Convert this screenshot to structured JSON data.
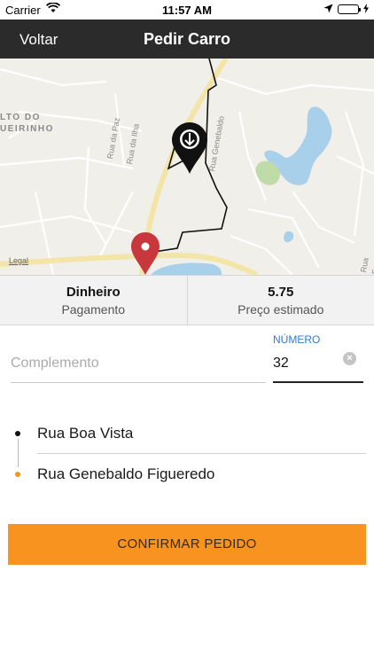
{
  "status_bar": {
    "carrier": "Carrier",
    "time": "11:57 AM"
  },
  "nav": {
    "back_label": "Voltar",
    "title": "Pedir Carro"
  },
  "map": {
    "labels": {
      "neighborhood": "LTO DO\nUEIRINHO",
      "street_paz": "Rua da Paz",
      "street_ilha": "Rua da Ilha",
      "street_genebaldo": "Rua Genebaldo",
      "street_right": "Rua F"
    },
    "legal": "Legal",
    "origin_pin_icon": "download-arrow-pin-icon",
    "destination_pin_icon": "map-marker-icon"
  },
  "info": {
    "payment_value": "Dinheiro",
    "payment_label": "Pagamento",
    "price_value": "5.75",
    "price_label": "Preço estimado"
  },
  "form": {
    "complemento_placeholder": "Complemento",
    "numero_label": "NÚMERO",
    "numero_value": "32"
  },
  "route": {
    "origin": "Rua Boa Vista",
    "destination": "Rua Genebaldo Figueredo",
    "origin_color": "#111111",
    "destination_color": "#f7931e"
  },
  "actions": {
    "confirm_label": "CONFIRMAR PEDIDO"
  },
  "colors": {
    "accent": "#f7931e",
    "nav_background": "#2b2b2b",
    "link_blue": "#2d7bd1",
    "pin_red": "#c8373b"
  }
}
